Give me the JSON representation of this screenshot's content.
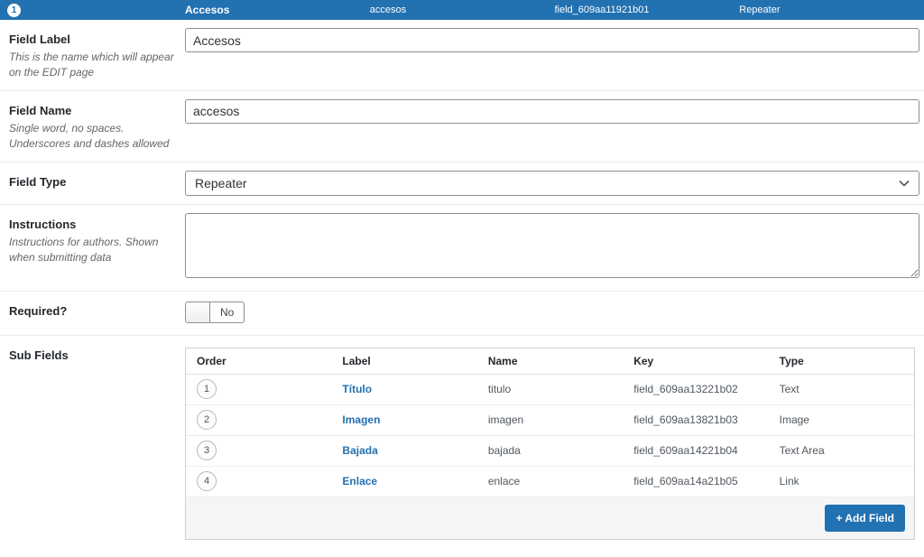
{
  "header": {
    "order": "1",
    "label": "Accesos",
    "name": "accesos",
    "key": "field_609aa11921b01",
    "type": "Repeater"
  },
  "settings": {
    "field_label": {
      "label": "Field Label",
      "description": "This is the name which will appear on the EDIT page",
      "value": "Accesos"
    },
    "field_name": {
      "label": "Field Name",
      "description": "Single word, no spaces. Underscores and dashes allowed",
      "value": "accesos"
    },
    "field_type": {
      "label": "Field Type",
      "value": "Repeater"
    },
    "instructions": {
      "label": "Instructions",
      "description": "Instructions for authors. Shown when submitting data",
      "value": ""
    },
    "required": {
      "label": "Required?",
      "value": "No"
    },
    "sub_fields_label": "Sub Fields"
  },
  "subfields": {
    "headers": [
      "Order",
      "Label",
      "Name",
      "Key",
      "Type"
    ],
    "rows": [
      {
        "order": "1",
        "label": "Título",
        "name": "titulo",
        "key": "field_609aa13221b02",
        "type": "Text"
      },
      {
        "order": "2",
        "label": "Imagen",
        "name": "imagen",
        "key": "field_609aa13821b03",
        "type": "Image"
      },
      {
        "order": "3",
        "label": "Bajada",
        "name": "bajada",
        "key": "field_609aa14221b04",
        "type": "Text Area"
      },
      {
        "order": "4",
        "label": "Enlace",
        "name": "enlace",
        "key": "field_609aa14a21b05",
        "type": "Link"
      }
    ],
    "add_field_label": "+ Add Field"
  },
  "colors": {
    "header_bg": "#2271b1",
    "link": "#2271b1",
    "button_bg": "#2271b1"
  }
}
